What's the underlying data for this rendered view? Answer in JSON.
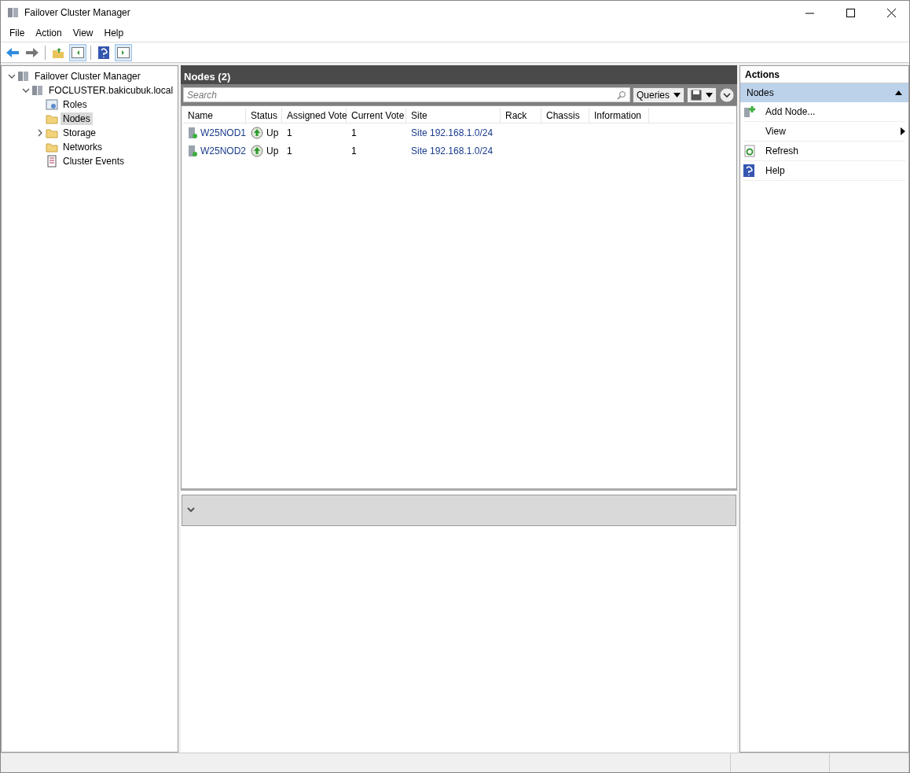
{
  "window": {
    "title": "Failover Cluster Manager"
  },
  "menu": [
    "File",
    "Action",
    "View",
    "Help"
  ],
  "tree": [
    {
      "label": "Failover Cluster Manager",
      "kind": "cluster",
      "selected": false,
      "expanded": true,
      "children": [
        {
          "label": "FOCLUSTER.bakicubuk.local",
          "kind": "cluster",
          "selected": false,
          "expanded": true,
          "children": [
            {
              "label": "Roles",
              "kind": "roles",
              "selected": false
            },
            {
              "label": "Nodes",
              "kind": "folder",
              "selected": true
            },
            {
              "label": "Storage",
              "kind": "folder",
              "selected": false,
              "expanded": false
            },
            {
              "label": "Networks",
              "kind": "folder",
              "selected": false
            },
            {
              "label": "Cluster Events",
              "kind": "events",
              "selected": false
            }
          ]
        }
      ]
    }
  ],
  "center": {
    "title": "Nodes (2)",
    "search": {
      "placeholder": "Search"
    },
    "queries": "Queries",
    "columns": [
      "Name",
      "Status",
      "Assigned Vote",
      "Current Vote",
      "Site",
      "Rack",
      "Chassis",
      "Information"
    ],
    "rows": [
      {
        "name": "W25NOD1",
        "status": "Up",
        "assigned_vote": "1",
        "current_vote": "1",
        "site": "Site 192.168.1.0/24"
      },
      {
        "name": "W25NOD2",
        "status": "Up",
        "assigned_vote": "1",
        "current_vote": "1",
        "site": "Site 192.168.1.0/24"
      }
    ]
  },
  "actions": {
    "title": "Actions",
    "section": "Nodes",
    "expanded": true,
    "items": [
      {
        "label": "Add Node...",
        "kind": "add"
      },
      {
        "label": "View",
        "kind": "submenu"
      },
      {
        "label": "Refresh",
        "kind": "refresh"
      },
      {
        "label": "Help",
        "kind": "help"
      }
    ]
  }
}
